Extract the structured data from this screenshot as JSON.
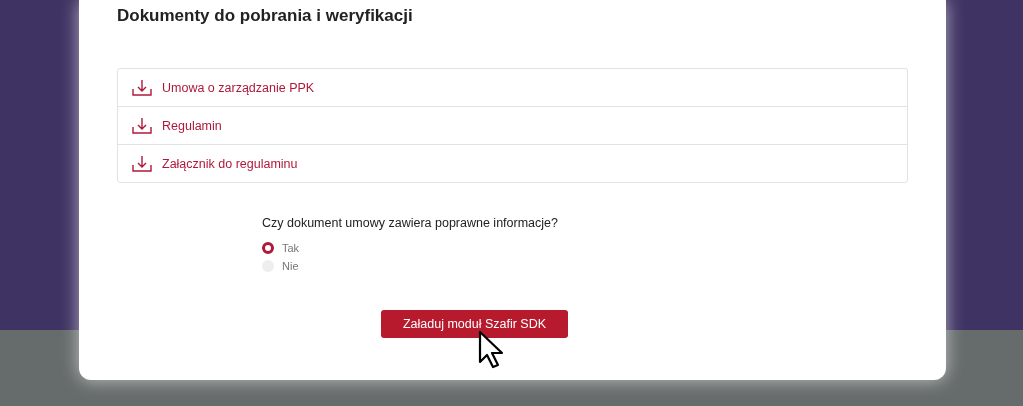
{
  "title": "Dokumenty do pobrania i weryfikacji",
  "documents": [
    {
      "label": "Umowa o zarządzanie PPK"
    },
    {
      "label": "Regulamin"
    },
    {
      "label": "Załącznik do regulaminu"
    }
  ],
  "question": {
    "text": "Czy dokument umowy zawiera poprawne informacje?",
    "options": [
      {
        "label": "Tak",
        "selected": true
      },
      {
        "label": "Nie",
        "selected": false
      }
    ]
  },
  "button": {
    "label": "Załaduj moduł Szafir SDK"
  }
}
